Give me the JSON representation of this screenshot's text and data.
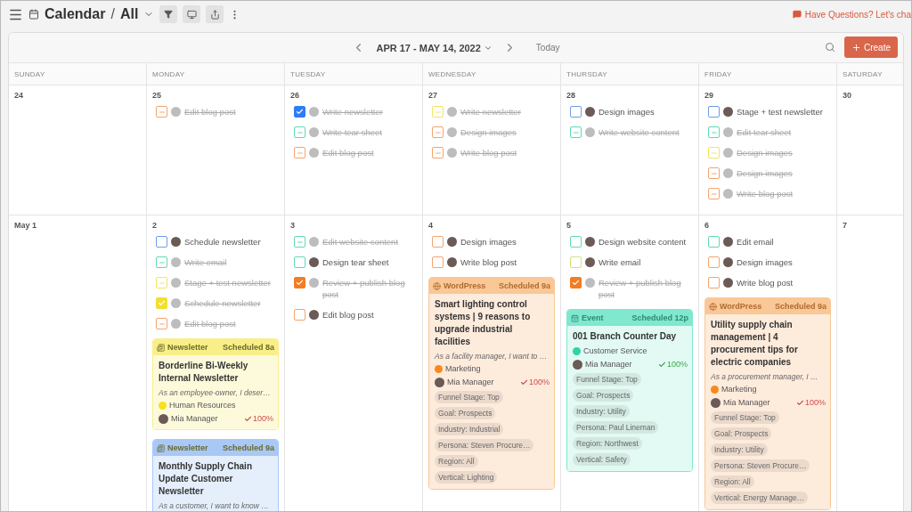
{
  "topbar": {
    "title": "Calendar",
    "separator": "/",
    "view": "All",
    "help_link": "Have Questions? Let's cha"
  },
  "toolbar": {
    "date_range": "APR 17 - MAY 14, 2022",
    "today": "Today",
    "create": "Create"
  },
  "weekdays": [
    "SUNDAY",
    "MONDAY",
    "TUESDAY",
    "WEDNESDAY",
    "THURSDAY",
    "FRIDAY",
    "SATURDAY"
  ],
  "weeks": [
    {
      "days": [
        {
          "date": "24"
        },
        {
          "date": "25",
          "items": [
            {
              "kind": "task",
              "label": "Edit blog post",
              "color": "#f4a46e",
              "checked": true
            }
          ]
        },
        {
          "date": "26",
          "items": [
            {
              "kind": "approval",
              "label": "Write newsletter",
              "color": "#2f7cf6",
              "checked": true
            },
            {
              "kind": "task",
              "label": "Write tear sheet",
              "color": "#5fd9b8",
              "checked": true
            },
            {
              "kind": "task",
              "label": "Edit blog post",
              "color": "#f4a46e",
              "checked": true
            }
          ]
        },
        {
          "date": "27",
          "items": [
            {
              "kind": "task",
              "label": "Write newsletter",
              "color": "#f2e55c",
              "checked": true
            },
            {
              "kind": "task",
              "label": "Design images",
              "color": "#f4a46e",
              "checked": true
            },
            {
              "kind": "task",
              "label": "Write blog post",
              "color": "#f4a46e",
              "checked": true
            }
          ]
        },
        {
          "date": "28",
          "items": [
            {
              "kind": "task",
              "label": "Design images",
              "color": "#6f9cf0",
              "checked": false
            },
            {
              "kind": "task",
              "label": "Write website content",
              "color": "#5fd9b8",
              "checked": true
            }
          ]
        },
        {
          "date": "29",
          "items": [
            {
              "kind": "task",
              "label": "Stage + test newsletter",
              "color": "#6f9cf0",
              "checked": false
            },
            {
              "kind": "task",
              "label": "Edit tear sheet",
              "color": "#5fd9b8",
              "checked": true
            },
            {
              "kind": "task",
              "label": "Design images",
              "color": "#f2e55c",
              "checked": true
            },
            {
              "kind": "task",
              "label": "Design images",
              "color": "#f4a46e",
              "checked": true
            },
            {
              "kind": "task",
              "label": "Write blog post",
              "color": "#f4a46e",
              "checked": true
            }
          ]
        },
        {
          "date": "30"
        }
      ]
    },
    {
      "days": [
        {
          "date": "May 1"
        },
        {
          "date": "2",
          "items": [
            {
              "kind": "task",
              "label": "Schedule newsletter",
              "color": "#6f9cf0",
              "checked": false
            },
            {
              "kind": "task",
              "label": "Write email",
              "color": "#5fd9b8",
              "checked": true
            },
            {
              "kind": "task",
              "label": "Stage + test newsletter",
              "color": "#f2e55c",
              "checked": true
            },
            {
              "kind": "approval",
              "label": "Schedule newsletter",
              "color": "#f2e02e",
              "checked": true
            },
            {
              "kind": "task",
              "label": "Edit blog post",
              "color": "#f4a46e",
              "checked": true
            },
            {
              "kind": "newsletter",
              "color": "#f9ef88",
              "label": "Newsletter",
              "scheduled": "Scheduled 8a",
              "title": "Borderline Bi-Weekly Internal Newsletter",
              "description": "As an employee-owner, I deser…",
              "category": {
                "name": "Human Resources",
                "color": "#f5e21c"
              },
              "owner": "Mia Manager",
              "progress": "100%"
            },
            {
              "kind": "newsletter",
              "color": "#a8c8f6",
              "label": "Newsletter",
              "scheduled": "Scheduled 9a",
              "title": "Monthly Supply Chain Update Customer Newsletter",
              "description": "As a customer, I want to know …"
            }
          ]
        },
        {
          "date": "3",
          "items": [
            {
              "kind": "task",
              "label": "Edit website content",
              "color": "#5fd9b8",
              "checked": true
            },
            {
              "kind": "task",
              "label": "Design tear sheet",
              "color": "#5fd9b8",
              "checked": false
            },
            {
              "kind": "approval",
              "label": "Review + publish blog post",
              "color": "#f57c22",
              "checked": true
            },
            {
              "kind": "task",
              "label": "Edit blog post",
              "color": "#f4a46e",
              "checked": false
            }
          ]
        },
        {
          "date": "4",
          "items": [
            {
              "kind": "task",
              "label": "Design images",
              "color": "#f4a46e",
              "checked": false
            },
            {
              "kind": "task",
              "label": "Write blog post",
              "color": "#f4a46e",
              "checked": false
            },
            {
              "kind": "wordpress",
              "color": "#f9c896",
              "label": "WordPress",
              "scheduled": "Scheduled 9a",
              "title": "Smart lighting control systems | 9 reasons to upgrade industrial facilities",
              "description": "As a facility manager, I want to …",
              "category": {
                "name": "Marketing",
                "color": "#f7891e"
              },
              "owner": "Mia Manager",
              "progress": "100%",
              "tags": [
                "Funnel Stage: Top",
                "Goal: Prospects",
                "Industry: Industrial",
                "Persona: Steven Procure…",
                "Region: All",
                "Vertical: Lighting"
              ]
            }
          ]
        },
        {
          "date": "5",
          "items": [
            {
              "kind": "task",
              "label": "Design website content",
              "color": "#5fd9b8",
              "checked": false
            },
            {
              "kind": "task",
              "label": "Write email",
              "color": "#c9e67a",
              "checked": false
            },
            {
              "kind": "approval",
              "label": "Review + publish blog post",
              "color": "#f57c22",
              "checked": true
            },
            {
              "kind": "event",
              "color": "#7fe8cf",
              "label": "Event",
              "scheduled": "Scheduled 12p",
              "title": "001 Branch Counter Day",
              "category": {
                "name": "Customer Service",
                "color": "#2ed3a6"
              },
              "owner": "Mia Manager",
              "progress": "100%",
              "tags": [
                "Funnel Stage: Top",
                "Goal: Prospects",
                "Industry: Utility",
                "Persona: Paul Lineman",
                "Region: Northwest",
                "Vertical: Safety"
              ]
            }
          ]
        },
        {
          "date": "6",
          "items": [
            {
              "kind": "task",
              "label": "Edit email",
              "color": "#5fd9b8",
              "checked": false
            },
            {
              "kind": "task",
              "label": "Design images",
              "color": "#f4a46e",
              "checked": false
            },
            {
              "kind": "task",
              "label": "Write blog post",
              "color": "#f4a46e",
              "checked": false
            },
            {
              "kind": "wordpress",
              "color": "#f9c896",
              "label": "WordPress",
              "scheduled": "Scheduled 9a",
              "title": "Utility supply chain management | 4 procurement tips for electric companies",
              "description": "As a procurement manager, I …",
              "category": {
                "name": "Marketing",
                "color": "#f7891e"
              },
              "owner": "Mia Manager",
              "progress": "100%",
              "tags": [
                "Funnel Stage: Top",
                "Goal: Prospects",
                "Industry: Utility",
                "Persona: Steven Procure…",
                "Region: All",
                "Vertical: Energy Manage…"
              ]
            }
          ]
        },
        {
          "date": "7"
        }
      ]
    }
  ]
}
